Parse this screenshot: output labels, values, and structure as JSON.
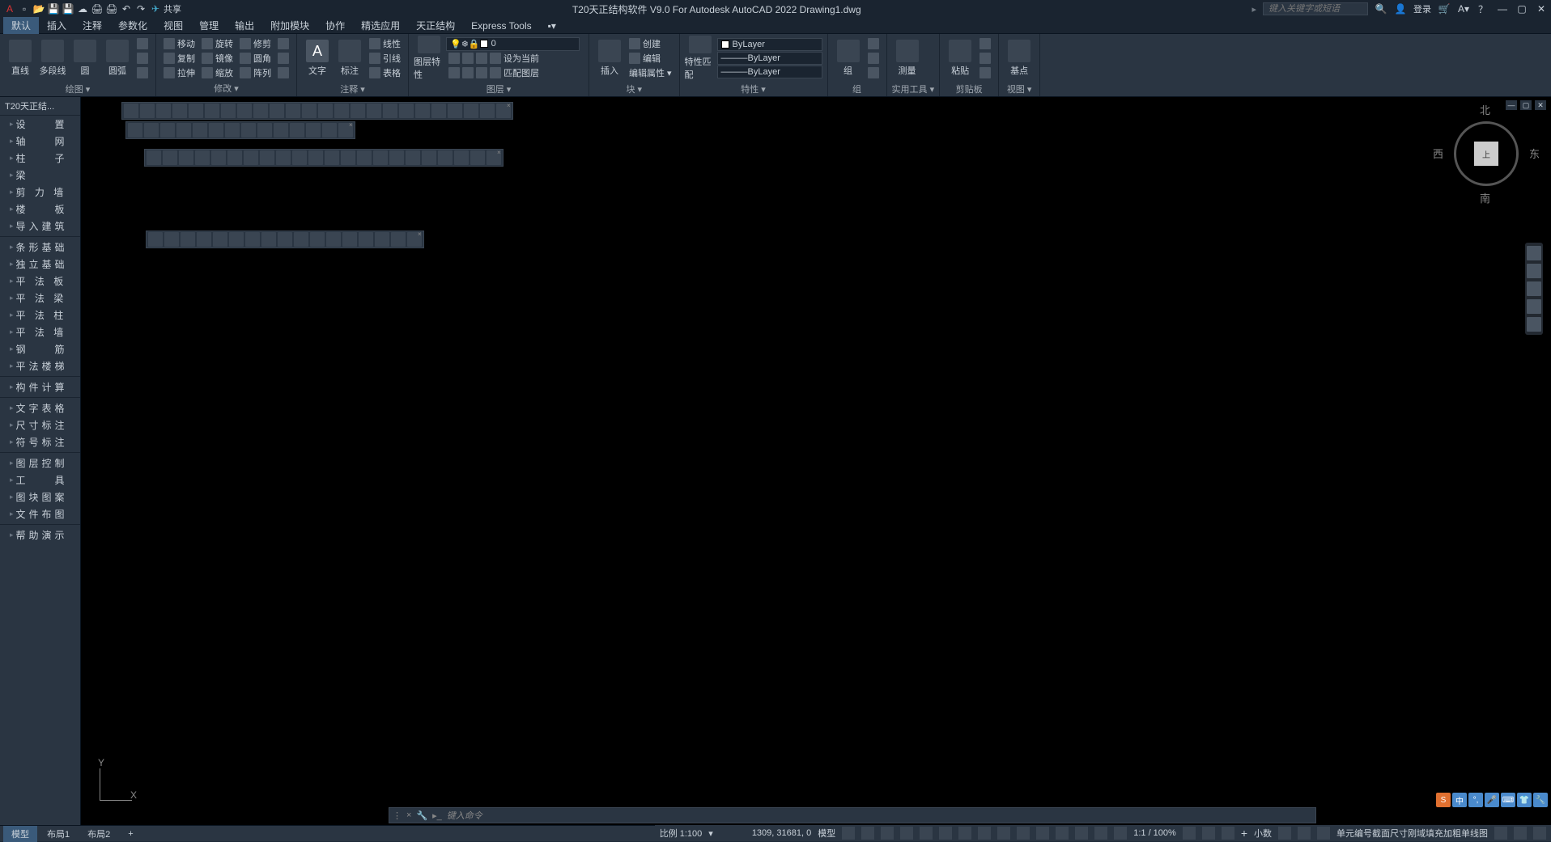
{
  "titlebar": {
    "app_logo": "A",
    "share": "共享",
    "title": "T20天正结构软件 V9.0 For Autodesk AutoCAD 2022   Drawing1.dwg",
    "search_placeholder": "键入关键字或短语",
    "login": "登录"
  },
  "menubar": [
    "默认",
    "插入",
    "注释",
    "参数化",
    "视图",
    "管理",
    "输出",
    "附加模块",
    "协作",
    "精选应用",
    "天正结构",
    "Express Tools"
  ],
  "ribbon": {
    "draw": {
      "btns": [
        "直线",
        "多段线",
        "圆",
        "圆弧"
      ],
      "label": "绘图"
    },
    "modify": {
      "rows": [
        [
          "移动",
          "旋转",
          "修剪"
        ],
        [
          "复制",
          "镜像",
          "圆角"
        ],
        [
          "拉伸",
          "缩放",
          "阵列"
        ]
      ],
      "label": "修改"
    },
    "annotation": {
      "btns": [
        "文字",
        "标注"
      ],
      "side": [
        "线性",
        "引线",
        "表格"
      ],
      "label": "注释"
    },
    "layer": {
      "btn": "图层特性",
      "side": [
        "设为当前",
        "匹配图层"
      ],
      "label": "图层",
      "current": "0"
    },
    "block": {
      "btn": "插入",
      "side": [
        "创建",
        "编辑",
        "编辑属性"
      ],
      "label": "块"
    },
    "properties": {
      "btn": "特性匹配",
      "label": "特性",
      "bylayer": "ByLayer"
    },
    "group": {
      "btn": "组",
      "label": "组"
    },
    "utility": {
      "btn": "测量",
      "label": "实用工具"
    },
    "clipboard": {
      "btn": "粘贴",
      "label": "剪贴板"
    },
    "view": {
      "btn": "基点",
      "label": "视图"
    }
  },
  "sidepanel": {
    "title": "T20天正结...",
    "group1": [
      "设　　置",
      "轴　　网",
      "柱　　子",
      "梁",
      "剪 力 墙",
      "楼　　板",
      "导入建筑"
    ],
    "group2": [
      "条形基础",
      "独立基础",
      "平 法 板",
      "平 法 梁",
      "平 法 柱",
      "平 法 墙",
      "钢　　筋",
      "平法楼梯"
    ],
    "group3": [
      "构件计算"
    ],
    "group4": [
      "文字表格",
      "尺寸标注",
      "符号标注"
    ],
    "group5": [
      "图层控制",
      "工　　具",
      "图块图案",
      "文件布图"
    ],
    "group6": [
      "帮助演示"
    ]
  },
  "viewcube": {
    "top": "上",
    "n": "北",
    "s": "南",
    "e": "东",
    "w": "西"
  },
  "ucs": {
    "y": "Y",
    "x": "X"
  },
  "cmdline": {
    "prompt": "键入命令"
  },
  "layout_tabs": {
    "tabs": [
      "模型",
      "布局1",
      "布局2"
    ],
    "add": "+"
  },
  "status": {
    "scale": "比例 1:100",
    "coords": "1309, 31681, 0",
    "model": "模型",
    "annoscale": "1:1 / 100%",
    "decimal": "小数",
    "right_text": "单元编号截面尺寸刚域填充加粗单线图"
  },
  "ime": {
    "logo": "S",
    "zh": "中"
  }
}
